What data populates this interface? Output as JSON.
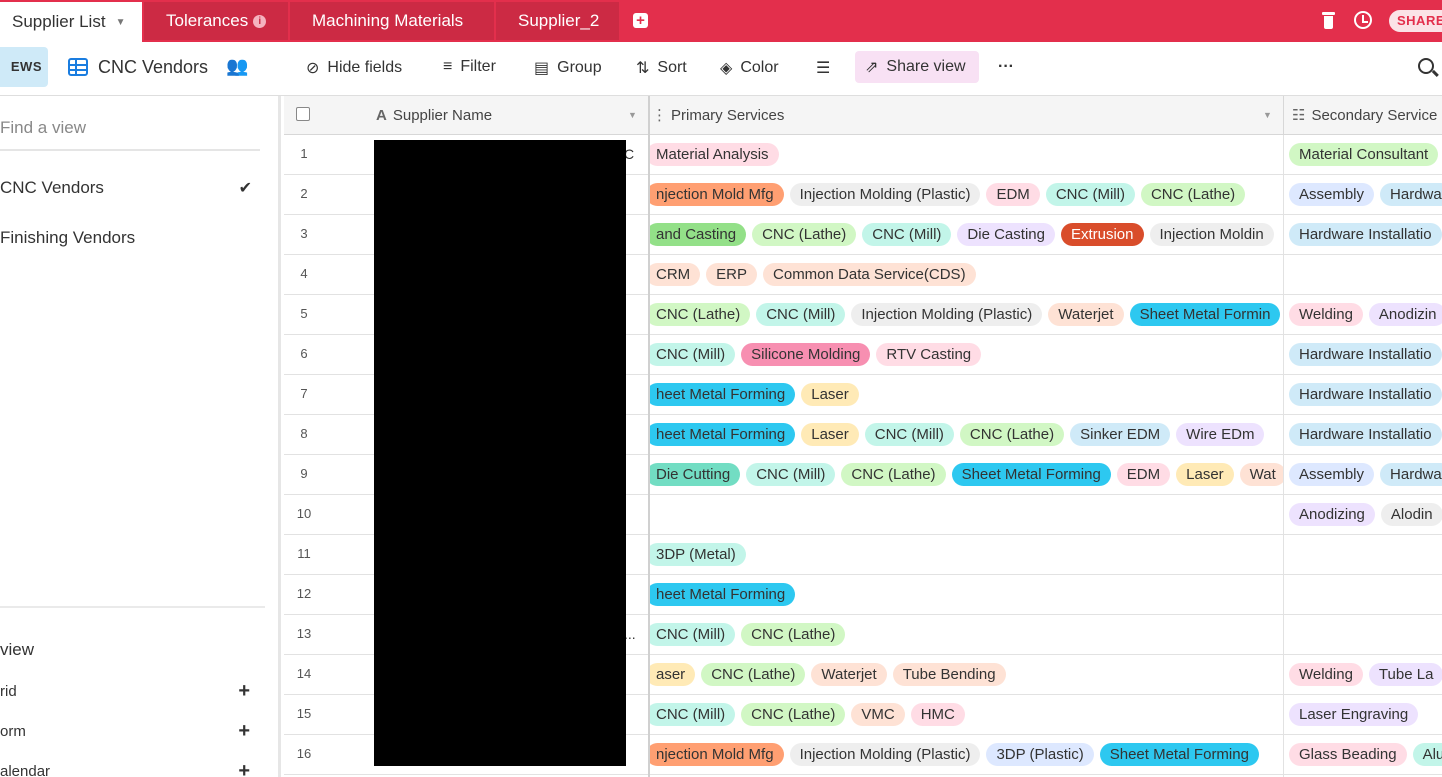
{
  "tabs": [
    {
      "label": "Supplier List",
      "active": true
    },
    {
      "label": "Tolerances",
      "has_info": true
    },
    {
      "label": "Machining Materials"
    },
    {
      "label": "Supplier_2"
    }
  ],
  "header": {
    "share_label": "SHARE"
  },
  "toolbar": {
    "views_label": "EWS",
    "view_name": "CNC Vendors",
    "hide_fields": "Hide fields",
    "filter": "Filter",
    "group": "Group",
    "sort": "Sort",
    "color": "Color",
    "share_view": "Share view",
    "more": "···"
  },
  "sidebar": {
    "find_placeholder": "Find a view",
    "views": [
      {
        "label": "CNC Vendors",
        "selected": true
      },
      {
        "label": "Finishing Vendors",
        "selected": false
      }
    ],
    "create_title": "view",
    "create_items": [
      "rid",
      "orm",
      "alendar"
    ]
  },
  "columns": {
    "supplier_name": "Supplier Name",
    "primary_services": "Primary Services",
    "secondary_services": "Secondary Service"
  },
  "colors": {
    "brand": "#e32f4c",
    "pill_light_blue": "#cfeaf8",
    "pill_teal": "#c2f5e9",
    "pill_green": "#d1f7c4",
    "pill_gray": "#eeeeee",
    "pill_pink": "#ffdce5",
    "pill_peach": "#fee2d5",
    "pill_orange": "#ff9f72",
    "pill_yellow": "#ffeab6",
    "pill_purple": "#ede2fe",
    "pill_blue": "#dde8ff",
    "pill_cyan_dark": "#2dc8f0",
    "pill_pink_dark": "#f78fb1",
    "pill_green_dark": "#93e088",
    "pill_teal_dark": "#72ddc3",
    "pill_red_dark": "#d94d2b"
  },
  "rows": [
    {
      "num": "1",
      "name_suffix": "C",
      "primary": [
        {
          "t": "Material Analysis",
          "c": "pill_pink"
        }
      ],
      "secondary": [
        {
          "t": "Material Consultant",
          "c": "pill_green"
        }
      ]
    },
    {
      "num": "2",
      "name_suffix": "",
      "primary": [
        {
          "t": "njection Mold Mfg",
          "c": "pill_orange"
        },
        {
          "t": "Injection Molding (Plastic)",
          "c": "pill_gray"
        },
        {
          "t": "EDM",
          "c": "pill_pink"
        },
        {
          "t": "CNC (Mill)",
          "c": "pill_teal"
        },
        {
          "t": "CNC (Lathe)",
          "c": "pill_green"
        }
      ],
      "secondary": [
        {
          "t": "Assembly",
          "c": "pill_blue"
        },
        {
          "t": "Hardwa",
          "c": "pill_light_blue"
        }
      ]
    },
    {
      "num": "3",
      "name_suffix": "",
      "primary": [
        {
          "t": "and Casting",
          "c": "pill_green_dark"
        },
        {
          "t": "CNC (Lathe)",
          "c": "pill_green"
        },
        {
          "t": "CNC (Mill)",
          "c": "pill_teal"
        },
        {
          "t": "Die Casting",
          "c": "pill_purple"
        },
        {
          "t": "Extrusion",
          "c": "pill_red_dark"
        },
        {
          "t": "Injection Moldin",
          "c": "pill_gray"
        }
      ],
      "secondary": [
        {
          "t": "Hardware Installatio",
          "c": "pill_light_blue"
        }
      ]
    },
    {
      "num": "4",
      "name_suffix": "",
      "primary": [
        {
          "t": "CRM",
          "c": "pill_peach"
        },
        {
          "t": "ERP",
          "c": "pill_peach"
        },
        {
          "t": "Common Data Service(CDS)",
          "c": "pill_peach"
        }
      ],
      "secondary": []
    },
    {
      "num": "5",
      "name_suffix": "",
      "primary": [
        {
          "t": "CNC (Lathe)",
          "c": "pill_green"
        },
        {
          "t": "CNC (Mill)",
          "c": "pill_teal"
        },
        {
          "t": "Injection Molding (Plastic)",
          "c": "pill_gray"
        },
        {
          "t": "Waterjet",
          "c": "pill_peach"
        },
        {
          "t": "Sheet Metal Formin",
          "c": "pill_cyan_dark"
        }
      ],
      "secondary": [
        {
          "t": "Welding",
          "c": "pill_pink"
        },
        {
          "t": "Anodizin",
          "c": "pill_purple"
        }
      ]
    },
    {
      "num": "6",
      "name_suffix": "",
      "primary": [
        {
          "t": "CNC (Mill)",
          "c": "pill_teal"
        },
        {
          "t": "Silicone Molding",
          "c": "pill_pink_dark"
        },
        {
          "t": "RTV Casting",
          "c": "pill_pink"
        }
      ],
      "secondary": [
        {
          "t": "Hardware Installatio",
          "c": "pill_light_blue"
        }
      ]
    },
    {
      "num": "7",
      "name_suffix": "",
      "primary": [
        {
          "t": "heet Metal Forming",
          "c": "pill_cyan_dark"
        },
        {
          "t": "Laser",
          "c": "pill_yellow"
        }
      ],
      "secondary": [
        {
          "t": "Hardware Installatio",
          "c": "pill_light_blue"
        }
      ]
    },
    {
      "num": "8",
      "name_suffix": "",
      "primary": [
        {
          "t": "heet Metal Forming",
          "c": "pill_cyan_dark"
        },
        {
          "t": "Laser",
          "c": "pill_yellow"
        },
        {
          "t": "CNC (Mill)",
          "c": "pill_teal"
        },
        {
          "t": "CNC (Lathe)",
          "c": "pill_green"
        },
        {
          "t": "Sinker EDM",
          "c": "pill_light_blue"
        },
        {
          "t": "Wire EDm",
          "c": "pill_purple"
        }
      ],
      "secondary": [
        {
          "t": "Hardware Installatio",
          "c": "pill_light_blue"
        }
      ]
    },
    {
      "num": "9",
      "name_suffix": "",
      "primary": [
        {
          "t": "Die Cutting",
          "c": "pill_teal_dark"
        },
        {
          "t": "CNC (Mill)",
          "c": "pill_teal"
        },
        {
          "t": "CNC (Lathe)",
          "c": "pill_green"
        },
        {
          "t": "Sheet Metal Forming",
          "c": "pill_cyan_dark"
        },
        {
          "t": "EDM",
          "c": "pill_pink"
        },
        {
          "t": "Laser",
          "c": "pill_yellow"
        },
        {
          "t": "Wat",
          "c": "pill_peach"
        }
      ],
      "secondary": [
        {
          "t": "Assembly",
          "c": "pill_blue"
        },
        {
          "t": "Hardwa",
          "c": "pill_light_blue"
        }
      ]
    },
    {
      "num": "10",
      "name_suffix": "",
      "primary": [],
      "secondary": [
        {
          "t": "Anodizing",
          "c": "pill_purple"
        },
        {
          "t": "Alodin",
          "c": "pill_gray"
        }
      ]
    },
    {
      "num": "11",
      "name_suffix": "",
      "primary": [
        {
          "t": "3DP (Metal)",
          "c": "pill_teal"
        }
      ],
      "secondary": []
    },
    {
      "num": "12",
      "name_suffix": "",
      "primary": [
        {
          "t": "heet Metal Forming",
          "c": "pill_cyan_dark"
        }
      ],
      "secondary": []
    },
    {
      "num": "13",
      "name_suffix": "...",
      "primary": [
        {
          "t": "CNC (Mill)",
          "c": "pill_teal"
        },
        {
          "t": "CNC (Lathe)",
          "c": "pill_green"
        }
      ],
      "secondary": []
    },
    {
      "num": "14",
      "name_suffix": "",
      "primary": [
        {
          "t": "aser",
          "c": "pill_yellow"
        },
        {
          "t": "CNC (Lathe)",
          "c": "pill_green"
        },
        {
          "t": "Waterjet",
          "c": "pill_peach"
        },
        {
          "t": "Tube Bending",
          "c": "pill_peach"
        }
      ],
      "secondary": [
        {
          "t": "Welding",
          "c": "pill_pink"
        },
        {
          "t": "Tube La",
          "c": "pill_purple"
        }
      ]
    },
    {
      "num": "15",
      "name_suffix": "",
      "primary": [
        {
          "t": "CNC (Mill)",
          "c": "pill_teal"
        },
        {
          "t": "CNC (Lathe)",
          "c": "pill_green"
        },
        {
          "t": "VMC",
          "c": "pill_peach"
        },
        {
          "t": "HMC",
          "c": "pill_pink"
        }
      ],
      "secondary": [
        {
          "t": "Laser Engraving",
          "c": "pill_purple"
        }
      ]
    },
    {
      "num": "16",
      "name_suffix": "",
      "primary": [
        {
          "t": "njection Mold Mfg",
          "c": "pill_orange"
        },
        {
          "t": "Injection Molding (Plastic)",
          "c": "pill_gray"
        },
        {
          "t": "3DP (Plastic)",
          "c": "pill_blue"
        },
        {
          "t": "Sheet Metal Forming",
          "c": "pill_cyan_dark"
        }
      ],
      "secondary": [
        {
          "t": "Glass Beading",
          "c": "pill_pink"
        },
        {
          "t": "Alu",
          "c": "pill_teal"
        }
      ]
    }
  ]
}
